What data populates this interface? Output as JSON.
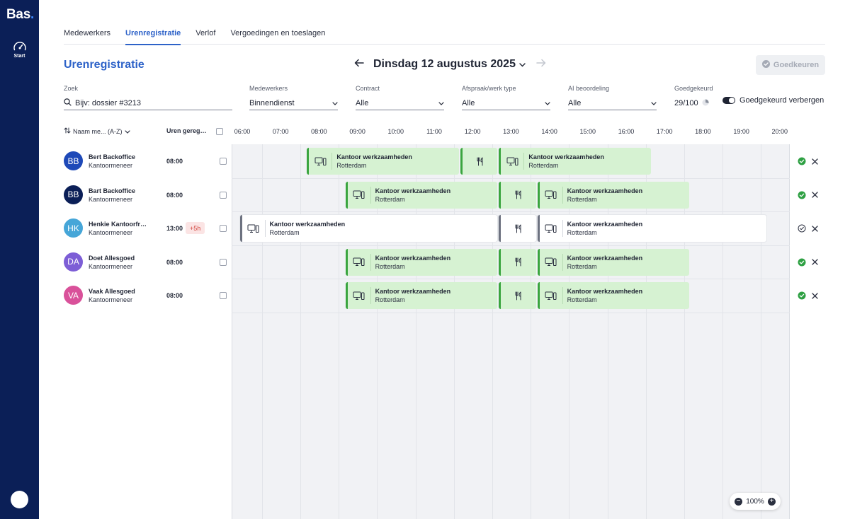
{
  "sidebar": {
    "logo": "Bas",
    "logo_dot": ".",
    "nav_start_label": "Start"
  },
  "tabs": [
    {
      "label": "Medewerkers",
      "active": false
    },
    {
      "label": "Urenregistratie",
      "active": true
    },
    {
      "label": "Verlof",
      "active": false
    },
    {
      "label": "Vergoedingen en toeslagen",
      "active": false
    }
  ],
  "page_title": "Urenregistratie",
  "date_nav": {
    "date": "Dinsdag 12 augustus 2025"
  },
  "approve_button": "Goedkeuren",
  "filters": {
    "search": {
      "label": "Zoek",
      "placeholder": "Bijv: dossier #3213"
    },
    "employees": {
      "label": "Medewerkers",
      "value": "Binnendienst"
    },
    "contract": {
      "label": "Contract",
      "value": "Alle"
    },
    "appointment_type": {
      "label": "Afspraak/werk type",
      "value": "Alle"
    },
    "ai_rating": {
      "label": "AI beoordeling",
      "value": "Alle"
    },
    "approved": {
      "label": "Goedgekeurd",
      "value": "29/100",
      "fraction": 0.29
    },
    "hide_approved": {
      "label": "Goedgekeurd verbergen",
      "on": true
    }
  },
  "columns": {
    "sort_label": "Naam me... (A-Z)",
    "hours_label": "Uren geregistreerd"
  },
  "hours": [
    "06:00",
    "07:00",
    "08:00",
    "09:00",
    "10:00",
    "11:00",
    "12:00",
    "13:00",
    "14:00",
    "15:00",
    "16:00",
    "17:00",
    "18:00",
    "19:00",
    "20:00"
  ],
  "rows": [
    {
      "initials": "BB",
      "avatar_color": "#1e49b8",
      "name": "Bert Backoffice",
      "role": "Kantoormeneer",
      "hours": "08:00",
      "extra": "",
      "approved": true,
      "blocks": [
        {
          "type": "work",
          "status": "approved",
          "title": "Kantoor werkzaamheden",
          "location": "Rotterdam",
          "start": "08:00",
          "end": "12:00"
        },
        {
          "type": "break",
          "status": "approved",
          "title": "",
          "location": "",
          "start": "12:00",
          "end": "13:00"
        },
        {
          "type": "work",
          "status": "approved",
          "title": "Kantoor werkzaamheden",
          "location": "Rotterdam",
          "start": "13:00",
          "end": "17:00"
        }
      ]
    },
    {
      "initials": "BB",
      "avatar_color": "#0b1f57",
      "name": "Bart Backoffice",
      "role": "Kantoormeneer",
      "hours": "08:00",
      "extra": "",
      "approved": true,
      "blocks": [
        {
          "type": "work",
          "status": "approved",
          "title": "Kantoor werkzaamheden",
          "location": "Rotterdam",
          "start": "09:00",
          "end": "13:00"
        },
        {
          "type": "break",
          "status": "approved",
          "title": "",
          "location": "",
          "start": "13:00",
          "end": "14:00"
        },
        {
          "type": "work",
          "status": "approved",
          "title": "Kantoor werkzaamheden",
          "location": "Rotterdam",
          "start": "14:00",
          "end": "18:00"
        }
      ]
    },
    {
      "initials": "HK",
      "avatar_color": "#46a6d8",
      "name": "Henkie Kantoorfreak",
      "role": "Kantoormeneer",
      "hours": "13:00",
      "extra": "+5h",
      "approved": false,
      "blocks": [
        {
          "type": "work",
          "status": "pending",
          "title": "Kantoor werkzaamheden",
          "location": "Rotterdam",
          "start": "06:15",
          "end": "13:00"
        },
        {
          "type": "break",
          "status": "pending",
          "title": "",
          "location": "",
          "start": "13:00",
          "end": "14:00"
        },
        {
          "type": "work",
          "status": "pending",
          "title": "Kantoor werkzaamheden",
          "location": "Rotterdam",
          "start": "14:00",
          "end": "20:00"
        }
      ]
    },
    {
      "initials": "DA",
      "avatar_color": "#7d5ed6",
      "name": "Doet Allesgoed",
      "role": "Kantoormeneer",
      "hours": "08:00",
      "extra": "",
      "approved": true,
      "blocks": [
        {
          "type": "work",
          "status": "approved",
          "title": "Kantoor werkzaamheden",
          "location": "Rotterdam",
          "start": "09:00",
          "end": "13:00"
        },
        {
          "type": "break",
          "status": "approved",
          "title": "",
          "location": "",
          "start": "13:00",
          "end": "14:00"
        },
        {
          "type": "work",
          "status": "approved",
          "title": "Kantoor werkzaamheden",
          "location": "Rotterdam",
          "start": "14:00",
          "end": "18:00"
        }
      ]
    },
    {
      "initials": "VA",
      "avatar_color": "#d9519a",
      "name": "Vaak Allesgoed",
      "role": "Kantoormeneer",
      "hours": "08:00",
      "extra": "",
      "approved": true,
      "blocks": [
        {
          "type": "work",
          "status": "approved",
          "title": "Kantoor werkzaamheden",
          "location": "Rotterdam",
          "start": "09:00",
          "end": "13:00"
        },
        {
          "type": "break",
          "status": "approved",
          "title": "",
          "location": "",
          "start": "13:00",
          "end": "14:00"
        },
        {
          "type": "work",
          "status": "approved",
          "title": "Kantoor werkzaamheden",
          "location": "Rotterdam",
          "start": "14:00",
          "end": "18:00"
        }
      ]
    }
  ],
  "zoom": {
    "level": "100%"
  },
  "colors": {
    "brand": "#0b1f57",
    "accent": "#2d62c8",
    "approved_block": "#d6f2d2",
    "approved_border": "#3aa53f",
    "approved_check": "#2ea043",
    "extra_badge_bg": "#fbe4e4",
    "extra_badge_text": "#d2463f"
  },
  "icons": [
    "dashboard-gauge-icon",
    "arrow-left-icon",
    "arrow-right-icon",
    "chevron-down-icon",
    "check-circle-icon",
    "search-icon",
    "pie-progress-icon",
    "sort-icon",
    "computer-icon",
    "cutlery-icon",
    "close-icon",
    "minus-icon",
    "plus-icon"
  ]
}
